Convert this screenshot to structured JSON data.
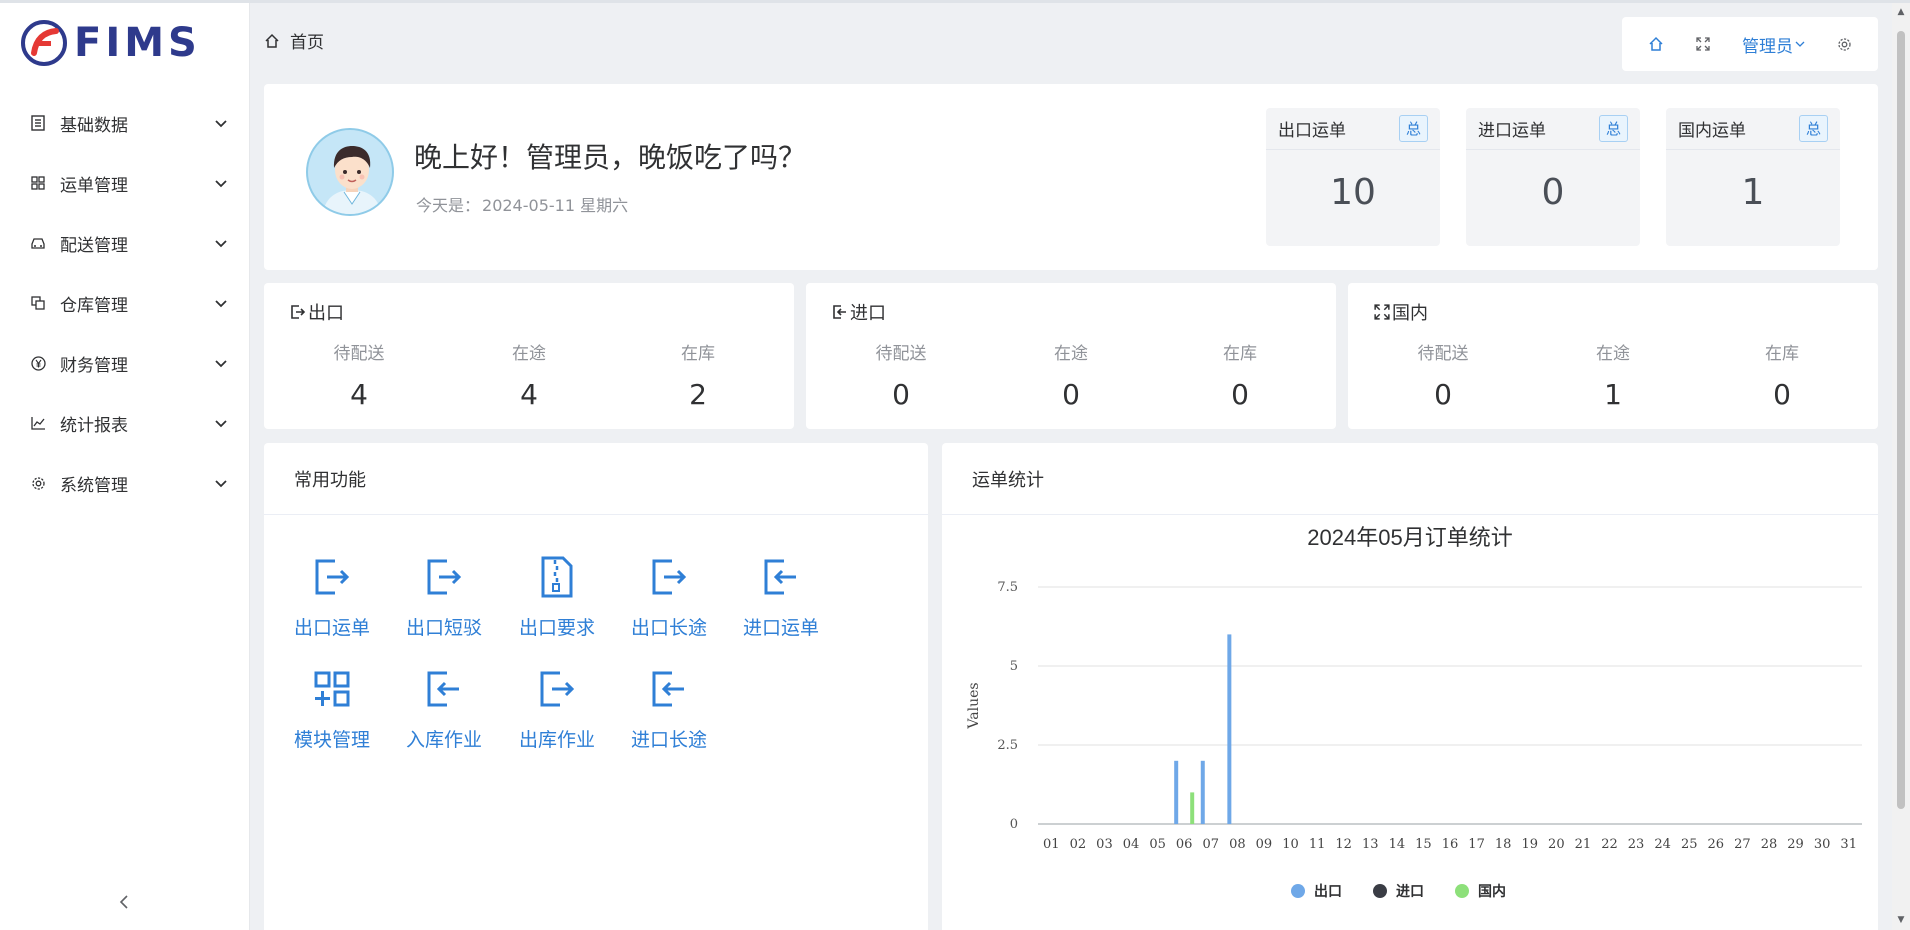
{
  "app": {
    "logo_text": "FIMS"
  },
  "sidebar": {
    "items": [
      {
        "label": "基础数据"
      },
      {
        "label": "运单管理"
      },
      {
        "label": "配送管理"
      },
      {
        "label": "仓库管理"
      },
      {
        "label": "财务管理"
      },
      {
        "label": "统计报表"
      },
      {
        "label": "系统管理"
      }
    ],
    "collapse_glyph": "<"
  },
  "header": {
    "breadcrumb": "首页",
    "user_label": "管理员"
  },
  "welcome": {
    "greeting": "晚上好！管理员，晚饭吃了吗？",
    "today_prefix": "今天是：",
    "today_value": "2024-05-11 星期六"
  },
  "summary_cards": [
    {
      "title": "出口运单",
      "badge": "总",
      "value": "10"
    },
    {
      "title": "进口运单",
      "badge": "总",
      "value": "0"
    },
    {
      "title": "国内运单",
      "badge": "总",
      "value": "1"
    }
  ],
  "status_panels": [
    {
      "title": "出口",
      "cols": [
        {
          "label": "待配送",
          "value": "4"
        },
        {
          "label": "在途",
          "value": "4"
        },
        {
          "label": "在库",
          "value": "2"
        }
      ]
    },
    {
      "title": "进口",
      "cols": [
        {
          "label": "待配送",
          "value": "0"
        },
        {
          "label": "在途",
          "value": "0"
        },
        {
          "label": "在库",
          "value": "0"
        }
      ]
    },
    {
      "title": "国内",
      "cols": [
        {
          "label": "待配送",
          "value": "0"
        },
        {
          "label": "在途",
          "value": "1"
        },
        {
          "label": "在库",
          "value": "0"
        }
      ]
    }
  ],
  "functions": {
    "title": "常用功能",
    "items": [
      {
        "label": "出口运单",
        "icon": "export-icon"
      },
      {
        "label": "出口短驳",
        "icon": "export-icon"
      },
      {
        "label": "出口要求",
        "icon": "zip-file-icon"
      },
      {
        "label": "出口长途",
        "icon": "export-icon"
      },
      {
        "label": "进口运单",
        "icon": "import-icon"
      },
      {
        "label": "模块管理",
        "icon": "module-grid-icon"
      },
      {
        "label": "入库作业",
        "icon": "import-icon"
      },
      {
        "label": "出库作业",
        "icon": "export-icon"
      },
      {
        "label": "进口长途",
        "icon": "import-icon"
      }
    ]
  },
  "chart_panel": {
    "title": "运单统计"
  },
  "chart_data": {
    "type": "bar",
    "title": "2024年05月订单统计",
    "ylabel": "Values",
    "xlabel": "",
    "ylim": [
      0,
      7.5
    ],
    "yticks": [
      "0",
      "2.5",
      "5",
      "7.5"
    ],
    "categories": [
      "01",
      "02",
      "03",
      "04",
      "05",
      "06",
      "07",
      "08",
      "09",
      "10",
      "11",
      "12",
      "13",
      "14",
      "15",
      "16",
      "17",
      "18",
      "19",
      "20",
      "21",
      "22",
      "23",
      "24",
      "25",
      "26",
      "27",
      "28",
      "29",
      "30",
      "31"
    ],
    "series": [
      {
        "name": "出口",
        "color": "#6fa8e8",
        "values": [
          0,
          0,
          0,
          0,
          0,
          2,
          2,
          6,
          0,
          0,
          0,
          0,
          0,
          0,
          0,
          0,
          0,
          0,
          0,
          0,
          0,
          0,
          0,
          0,
          0,
          0,
          0,
          0,
          0,
          0,
          0
        ]
      },
      {
        "name": "进口",
        "color": "#3a3d45",
        "values": [
          0,
          0,
          0,
          0,
          0,
          0,
          0,
          0,
          0,
          0,
          0,
          0,
          0,
          0,
          0,
          0,
          0,
          0,
          0,
          0,
          0,
          0,
          0,
          0,
          0,
          0,
          0,
          0,
          0,
          0,
          0
        ]
      },
      {
        "name": "国内",
        "color": "#8de07a",
        "values": [
          0,
          0,
          0,
          0,
          0,
          1,
          0,
          0,
          0,
          0,
          0,
          0,
          0,
          0,
          0,
          0,
          0,
          0,
          0,
          0,
          0,
          0,
          0,
          0,
          0,
          0,
          0,
          0,
          0,
          0,
          0
        ]
      }
    ],
    "legend_position": "bottom-center",
    "grid": true
  }
}
